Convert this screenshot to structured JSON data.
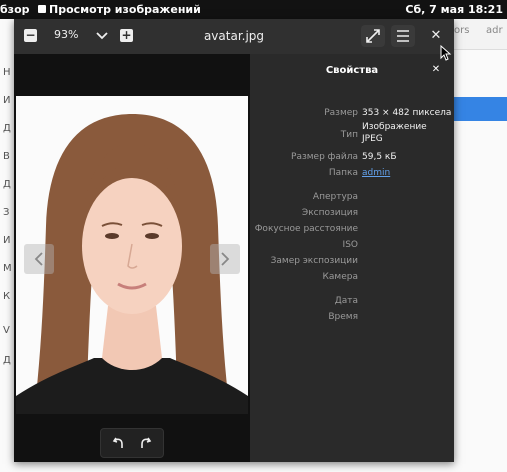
{
  "topbar": {
    "activities": "бзор",
    "app_name": "Просмотр изображений",
    "clock": "Сб, 7 мая  18:21"
  },
  "background": {
    "tab1": "ors",
    "tab2": "adr",
    "sidebar_letters": [
      "Н",
      "И",
      "Д",
      "В",
      "Д",
      "З",
      "И",
      "М",
      "К",
      "V",
      "Д"
    ]
  },
  "viewer": {
    "zoom": "93%",
    "title": "avatar.jpg",
    "properties": {
      "title": "Свойства",
      "size_label": "Размер",
      "size_value": "353 × 482 пиксела",
      "type_label": "Тип",
      "type_value_1": "Изображение",
      "type_value_2": "JPEG",
      "filesize_label": "Размер файла",
      "filesize_value": "59,5 кБ",
      "folder_label": "Папка",
      "folder_value": "admin",
      "aperture_label": "Апертура",
      "exposure_label": "Экспозиция",
      "focal_label": "Фокусное расстояние",
      "iso_label": "ISO",
      "metering_label": "Замер экспозиции",
      "camera_label": "Камера",
      "date_label": "Дата",
      "time_label": "Время"
    }
  },
  "icons": {
    "zoom_out": "minus-icon",
    "zoom_dropdown": "chevron-down-icon",
    "zoom_in": "plus-icon",
    "fullscreen": "fullscreen-icon",
    "menu": "hamburger-icon",
    "close": "close-icon",
    "prev": "chevron-left-icon",
    "next": "chevron-right-icon",
    "rotate_left": "rotate-left-icon",
    "rotate_right": "rotate-right-icon"
  }
}
